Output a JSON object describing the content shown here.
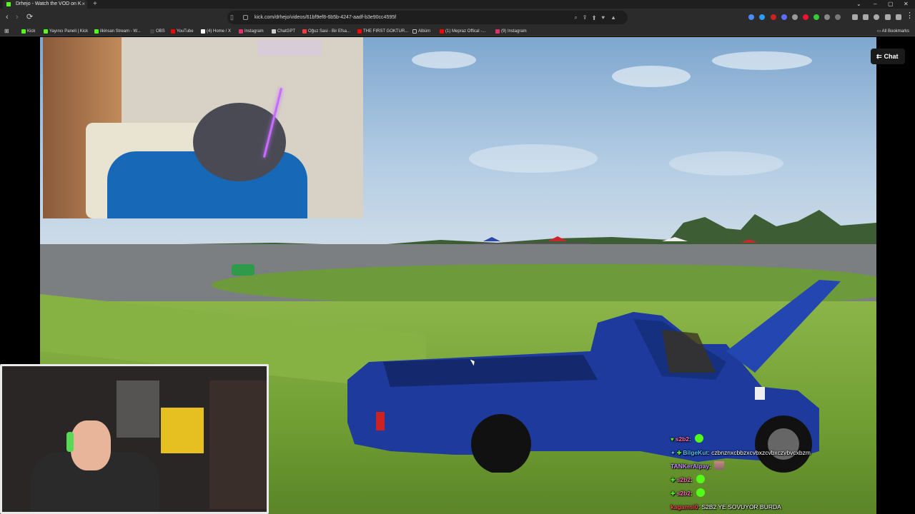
{
  "tab": {
    "title": "Drhejo - Watch the VOD on K",
    "close": "×"
  },
  "window": {
    "new_tab": "+",
    "dropdown": "⌄",
    "minimize": "–",
    "maximize": "▢",
    "close": "✕"
  },
  "address": {
    "url": "kick.com/drhejo/videos/61bf9ef8-6b5b-4247-aadf-b3e90cc4595f"
  },
  "nav": {
    "back": "‹",
    "forward": "›",
    "reload": "⟳"
  },
  "bookmarks": {
    "items": [
      {
        "label": "Kick",
        "color": "#53fc18"
      },
      {
        "label": "Yayıncı Paneli | Kick",
        "color": "#53fc18"
      },
      {
        "label": "ilkinsan Stream - W...",
        "color": "#53fc18"
      },
      {
        "label": "OBS",
        "color": "#444444"
      },
      {
        "label": "YouTube",
        "color": "#ff0000"
      },
      {
        "label": "(4) Home / X",
        "color": "#ffffff"
      },
      {
        "label": "Instagram",
        "color": "#e1306c"
      },
      {
        "label": "ChatGPT",
        "color": "#cccccc"
      },
      {
        "label": "Oğuz Sasi - Bir Efsa...",
        "color": "#ff3b3b"
      },
      {
        "label": "THE FIRST GOKTUR...",
        "color": "#ff0000"
      },
      {
        "label": "Albüm",
        "color": "#888888"
      },
      {
        "label": "(1) Mepraz Offical -...",
        "color": "#ff0000"
      },
      {
        "label": "(9) Instagram",
        "color": "#e1306c"
      }
    ],
    "all_label": "All Bookmarks"
  },
  "player": {
    "chat_button": "Chat"
  },
  "chat": {
    "messages": [
      {
        "user": "s2b2",
        "user_color": "#ff6eb4",
        "text": "",
        "emote": "green-face"
      },
      {
        "user": "BilgeKut",
        "user_color": "#4fc3ff",
        "text": "czbnznxcbbzxcvbxzcvbxczvbvcxbzm",
        "emote": ""
      },
      {
        "user": "TANKerAlpay",
        "user_color": "#c58bff",
        "text": "",
        "emote": "face-image"
      },
      {
        "user": "s2b2",
        "user_color": "#ff6eb4",
        "text": "",
        "emote": "green-face"
      },
      {
        "user": "s2b2",
        "user_color": "#ff6eb4",
        "text": "",
        "emote": "green-face"
      },
      {
        "user": "kagamsi0",
        "user_color": "#ff4b4b",
        "text": "S2B2 YE SOVUYOR BURDA",
        "emote": ""
      }
    ]
  }
}
